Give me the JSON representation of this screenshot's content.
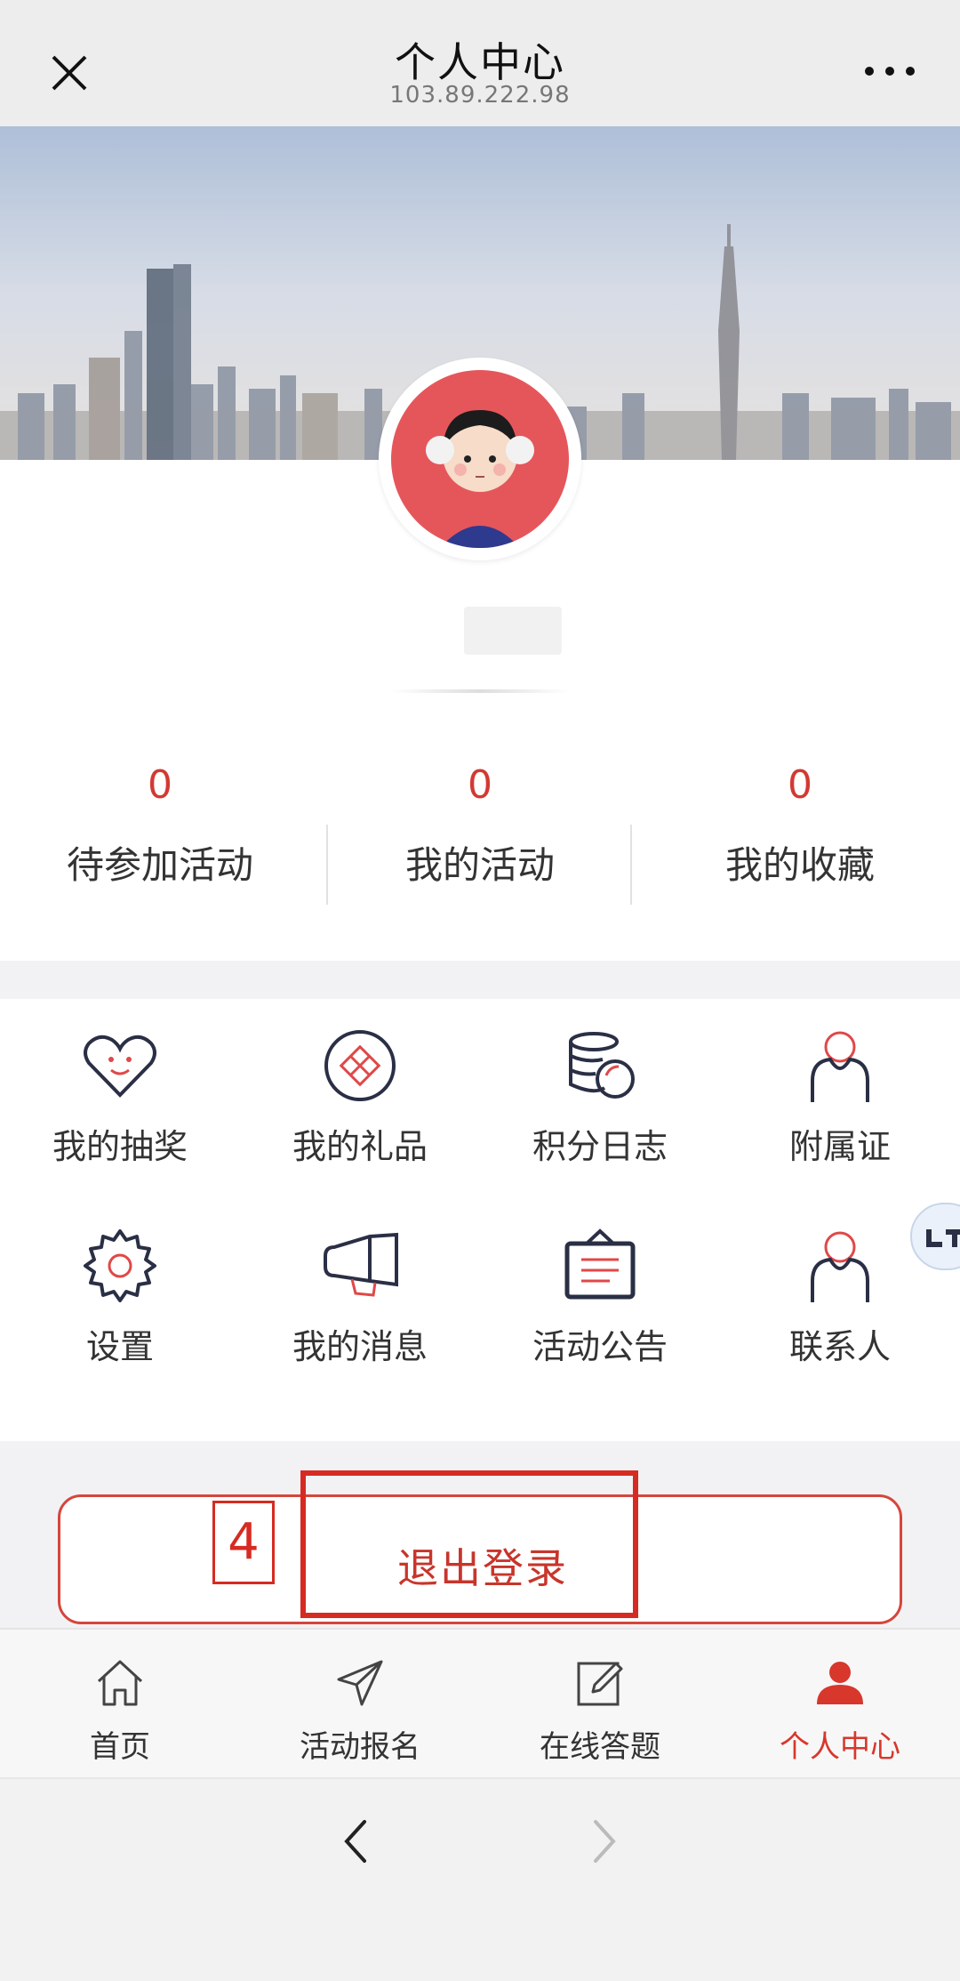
{
  "header": {
    "title": "个人中心",
    "subtitle": "103.89.222.98"
  },
  "stats": [
    {
      "value": "0",
      "label": "待参加活动"
    },
    {
      "value": "0",
      "label": "我的活动"
    },
    {
      "value": "0",
      "label": "我的收藏"
    }
  ],
  "menu": [
    {
      "label": "我的抽奖",
      "icon": "heart-smile-icon"
    },
    {
      "label": "我的礼品",
      "icon": "gift-icon"
    },
    {
      "label": "积分日志",
      "icon": "coins-icon"
    },
    {
      "label": "附属证",
      "icon": "person-icon"
    },
    {
      "label": "设置",
      "icon": "gear-icon"
    },
    {
      "label": "我的消息",
      "icon": "megaphone-icon"
    },
    {
      "label": "活动公告",
      "icon": "notice-board-icon"
    },
    {
      "label": "联系人",
      "icon": "contact-icon"
    }
  ],
  "logout": {
    "label": "退出登录",
    "annotation": "4"
  },
  "bottom_nav": [
    {
      "label": "首页",
      "icon": "home-icon"
    },
    {
      "label": "活动报名",
      "icon": "send-icon"
    },
    {
      "label": "在线答题",
      "icon": "edit-icon"
    },
    {
      "label": "个人中心",
      "icon": "user-icon",
      "active": true
    }
  ],
  "colors": {
    "accent": "#d23a32",
    "active_nav": "#d8372c"
  }
}
